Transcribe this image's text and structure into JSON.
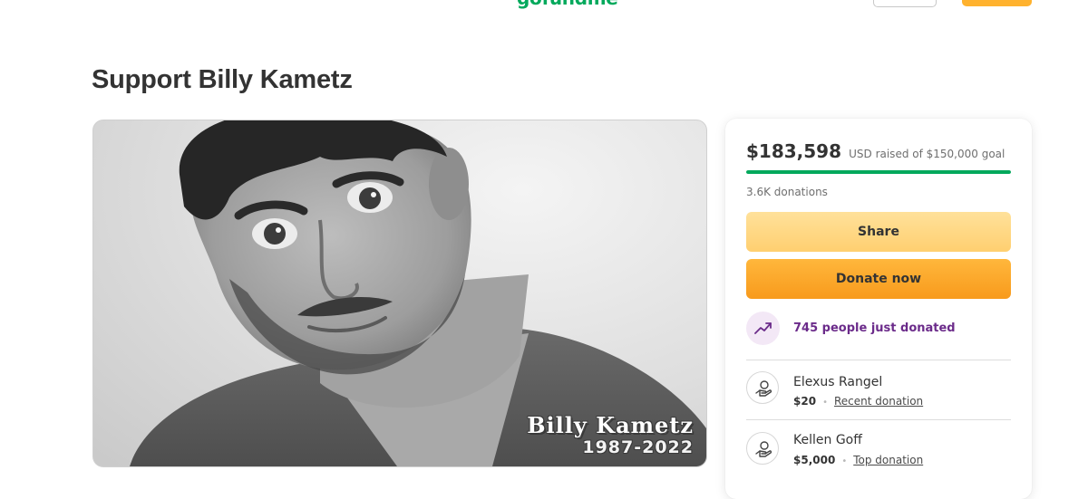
{
  "header": {
    "logo_text": "gofundme"
  },
  "page": {
    "title": "Support Billy Kametz"
  },
  "hero": {
    "caption_name": "Billy Kametz",
    "caption_years": "1987-2022"
  },
  "sidebar": {
    "raised_amount": "$183,598",
    "raised_goal_text": "USD raised of $150,000 goal",
    "progress_fraction": 1.0,
    "donation_count": "3.6K donations",
    "share_label": "Share",
    "donate_label": "Donate now",
    "trend_text": "745 people just donated",
    "donors": [
      {
        "name": "Elexus Rangel",
        "amount": "$20",
        "tag": "Recent donation"
      },
      {
        "name": "Kellen Goff",
        "amount": "$5,000",
        "tag": "Top donation"
      }
    ]
  },
  "colors": {
    "brand_green": "#02a95c",
    "donate_orange": "#f89a1c",
    "share_yellow": "#ffd27a",
    "trend_purple": "#6b2b8a"
  },
  "icons": {
    "trend": "trending-up-icon",
    "donor": "heart-hand-icon"
  }
}
